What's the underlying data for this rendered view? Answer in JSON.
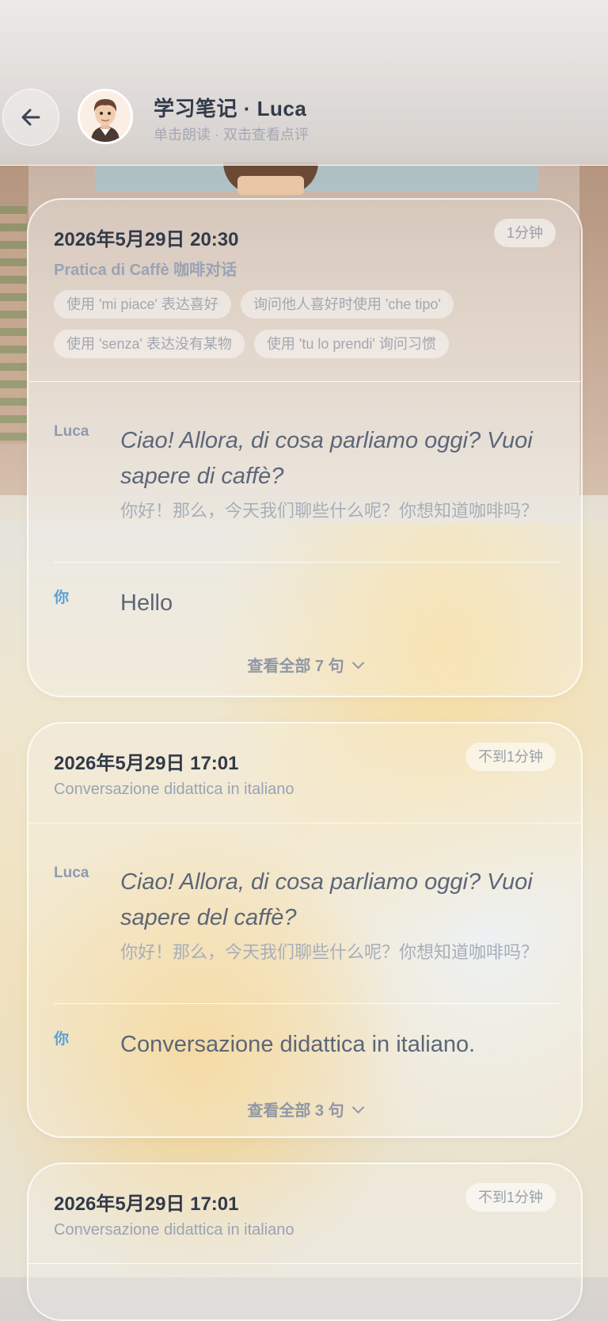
{
  "header": {
    "title": "学习笔记 · Luca",
    "subtitle": "单击朗读 · 双击查看点评"
  },
  "cards": [
    {
      "date": "2026年5月29日 20:30",
      "duration": "1分钟",
      "topic": "Pratica di Caffè 咖啡对话",
      "tags": [
        "使用 'mi piace' 表达喜好",
        "询问他人喜好时使用 'che tipo'",
        "使用 'senza' 表达没有某物",
        "使用 'tu lo prendi' 询问习惯"
      ],
      "messages": [
        {
          "speaker": "Luca",
          "italian": "Ciao! Allora, di cosa parliamo oggi? Vuoi sapere di caffè?",
          "chinese": "你好！那么，今天我们聊些什么呢？你想知道咖啡吗？"
        },
        {
          "speaker": "你",
          "text": "Hello"
        }
      ],
      "more_label": "查看全部 7 句"
    },
    {
      "date": "2026年5月29日 17:01",
      "duration": "不到1分钟",
      "topic": "Conversazione didattica in italiano",
      "messages": [
        {
          "speaker": "Luca",
          "italian": "Ciao! Allora, di cosa parliamo oggi? Vuoi sapere del caffè?",
          "chinese": "你好！那么，今天我们聊些什么呢？你想知道咖啡吗？"
        },
        {
          "speaker": "你",
          "text": "Conversazione didattica in italiano."
        }
      ],
      "more_label": "查看全部 3 句"
    },
    {
      "date": "2026年5月29日 17:01",
      "duration": "不到1分钟",
      "topic": "Conversazione didattica in italiano"
    }
  ]
}
